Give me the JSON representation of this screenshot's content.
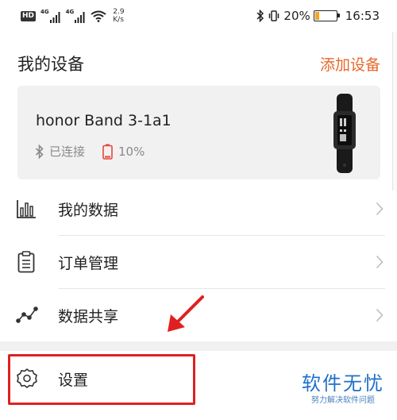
{
  "status_bar": {
    "hd": "HD",
    "signal_1_tag": "4G",
    "signal_2_tag": "4G",
    "net_speed_value": "2.9",
    "net_speed_unit": "K/s",
    "battery_percent": "20%",
    "battery_level": 0.2,
    "time": "16:53"
  },
  "header": {
    "title": "我的设备",
    "add_device": "添加设备"
  },
  "device": {
    "name": "honor Band 3-1a1",
    "connection": "已连接",
    "battery": "10%"
  },
  "menu": [
    {
      "label": "我的数据",
      "icon": "bar-chart-icon"
    },
    {
      "label": "订单管理",
      "icon": "clipboard-icon"
    },
    {
      "label": "数据共享",
      "icon": "share-graph-icon"
    },
    {
      "label": "设置",
      "icon": "gear-icon"
    }
  ],
  "watermark": {
    "main": "软件无忧",
    "sub": "努力解决软件问题"
  },
  "colors": {
    "accent": "#e8672b",
    "highlight": "#e02020",
    "watermark": "#1f6fc9",
    "battery_low": "#e8453c"
  }
}
